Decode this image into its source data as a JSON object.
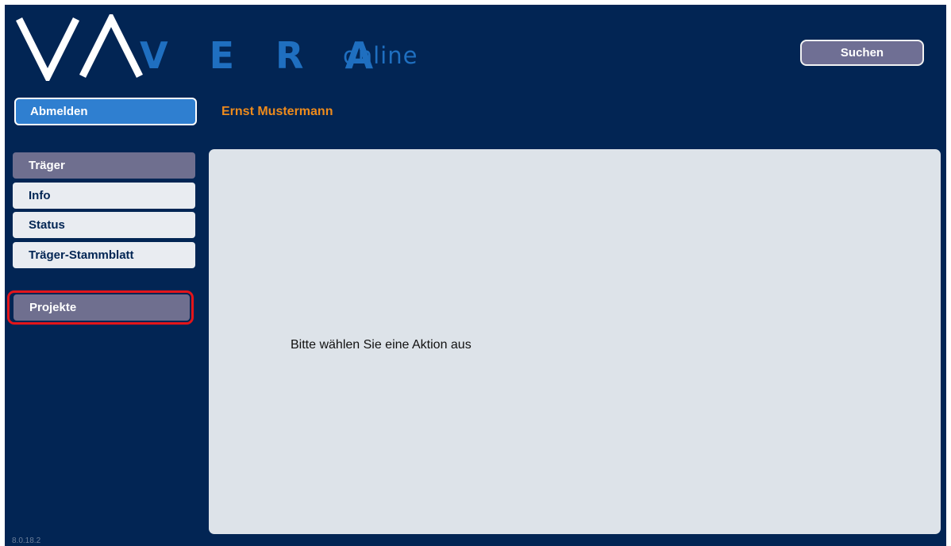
{
  "header": {
    "logo_word": "V E R A",
    "logo_suffix": "online",
    "search_label": "Suchen"
  },
  "session": {
    "logout_label": "Abmelden",
    "user_name": "Ernst Mustermann"
  },
  "sidebar": {
    "group_traeger": "Träger",
    "items": [
      {
        "label": "Info"
      },
      {
        "label": "Status"
      },
      {
        "label": "Träger-Stammblatt"
      }
    ],
    "group_projekte": "Projekte"
  },
  "content": {
    "message": "Bitte wählen Sie eine Aktion aus"
  },
  "footer": {
    "version": "8.0.18.2"
  },
  "colors": {
    "background": "#022554",
    "logo_blue": "#1f6fc0",
    "accent_orange": "#ee8b1c",
    "highlight_red": "#e3151a",
    "panel": "#dde3e9"
  }
}
